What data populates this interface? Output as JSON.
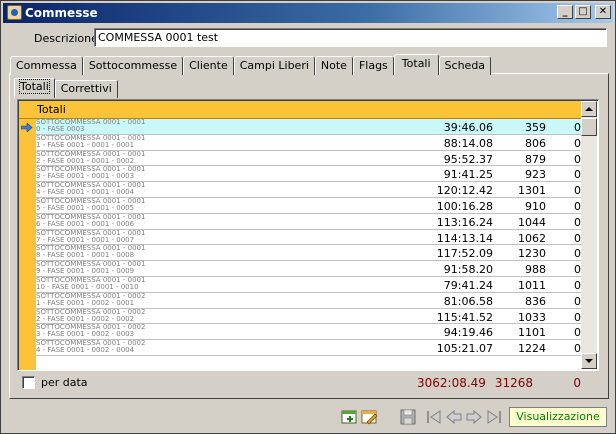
{
  "window": {
    "title": "Commesse",
    "controls": [
      "_",
      "□",
      "✕"
    ]
  },
  "descrizione": {
    "label": "Descrizione",
    "value": "COMMESSA 0001 test"
  },
  "tabs": [
    {
      "label": "Commessa"
    },
    {
      "label": "Sottocommesse"
    },
    {
      "label": "Cliente"
    },
    {
      "label": "Campi Liberi"
    },
    {
      "label": "Note"
    },
    {
      "label": "Flags"
    },
    {
      "label": "Totali"
    },
    {
      "label": "Scheda"
    }
  ],
  "subtabs": [
    {
      "label": "Totali"
    },
    {
      "label": "Correttivi"
    }
  ],
  "grid": {
    "group_header": "Totali",
    "rows": [
      {
        "line1": "SOTTOCOMMESSA 0001 - 0001",
        "line2": "0 - FASE 0003",
        "time": "39:46.06",
        "count": "359",
        "zero": "0"
      },
      {
        "line1": "SOTTOCOMMESSA 0001 - 0001",
        "line2": "1 - FASE 0001 - 0001 - 0001",
        "time": "88:14.08",
        "count": "806",
        "zero": "0"
      },
      {
        "line1": "SOTTOCOMMESSA 0001 - 0001",
        "line2": "2 - FASE 0001 - 0001 - 0002",
        "time": "95:52.37",
        "count": "879",
        "zero": "0"
      },
      {
        "line1": "SOTTOCOMMESSA 0001 - 0001",
        "line2": "3 - FASE 0001 - 0001 - 0003",
        "time": "91:41.25",
        "count": "923",
        "zero": "0"
      },
      {
        "line1": "SOTTOCOMMESSA 0001 - 0001",
        "line2": "4 - FASE 0001 - 0001 - 0004",
        "time": "120:12.42",
        "count": "1301",
        "zero": "0"
      },
      {
        "line1": "SOTTOCOMMESSA 0001 - 0001",
        "line2": "5 - FASE 0001 - 0001 - 0005",
        "time": "100:16.28",
        "count": "910",
        "zero": "0"
      },
      {
        "line1": "SOTTOCOMMESSA 0001 - 0001",
        "line2": "6 - FASE 0001 - 0001 - 0006",
        "time": "113:16.24",
        "count": "1044",
        "zero": "0"
      },
      {
        "line1": "SOTTOCOMMESSA 0001 - 0001",
        "line2": "7 - FASE 0001 - 0001 - 0007",
        "time": "114:13.14",
        "count": "1062",
        "zero": "0"
      },
      {
        "line1": "SOTTOCOMMESSA 0001 - 0001",
        "line2": "8 - FASE 0001 - 0001 - 0008",
        "time": "117:52.09",
        "count": "1230",
        "zero": "0"
      },
      {
        "line1": "SOTTOCOMMESSA 0001 - 0001",
        "line2": "9 - FASE 0001 - 0001 - 0009",
        "time": "91:58.20",
        "count": "988",
        "zero": "0"
      },
      {
        "line1": "SOTTOCOMMESSA 0001 - 0001",
        "line2": "10 - FASE 0001 - 0001 - 0010",
        "time": "79:41.24",
        "count": "1011",
        "zero": "0"
      },
      {
        "line1": "SOTTOCOMMESSA 0001 - 0002",
        "line2": "1 - FASE 0001 - 0002 - 0001",
        "time": "81:06.58",
        "count": "836",
        "zero": "0"
      },
      {
        "line1": "SOTTOCOMMESSA 0001 - 0002",
        "line2": "2 - FASE 0001 - 0002 - 0002",
        "time": "115:41.52",
        "count": "1033",
        "zero": "0"
      },
      {
        "line1": "SOTTOCOMMESSA 0001 - 0002",
        "line2": "3 - FASE 0001 - 0002 - 0003",
        "time": "94:19.46",
        "count": "1101",
        "zero": "0"
      },
      {
        "line1": "SOTTOCOMMESSA 0001 - 0002",
        "line2": "4 - FASE 0001 - 0002 - 0004",
        "time": "105:21.07",
        "count": "1224",
        "zero": "0"
      }
    ]
  },
  "footer": {
    "per_data_label": "per data",
    "total_time": "3062:08.49",
    "total_count": "31268",
    "total_zero": "0"
  },
  "mode": "Visualizzazione",
  "icons": [
    "add-record-icon",
    "edit-record-icon",
    "save-icon",
    "first-record-icon",
    "prev-record-icon",
    "next-record-icon",
    "last-record-icon"
  ]
}
